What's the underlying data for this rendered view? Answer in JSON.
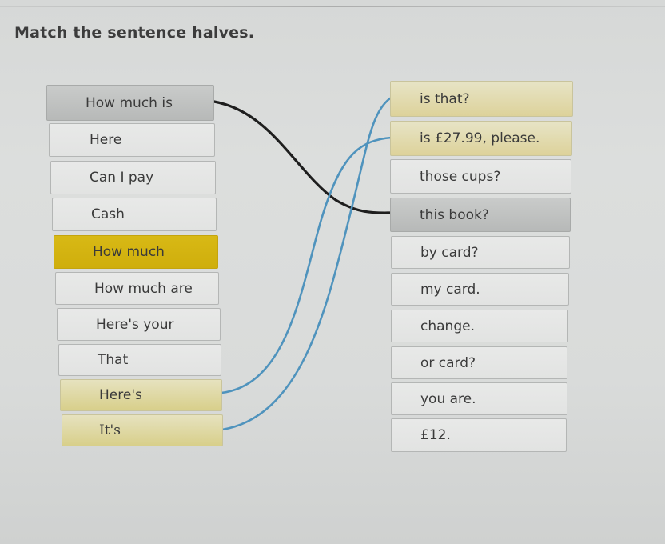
{
  "title": "Match the sentence halves.",
  "left_items": [
    {
      "label": "How much is",
      "state": "matched-dark"
    },
    {
      "label": "Here",
      "state": "default"
    },
    {
      "label": "Can I pay",
      "state": "default"
    },
    {
      "label": "Cash",
      "state": "default"
    },
    {
      "label": "How much",
      "state": "selected"
    },
    {
      "label": "How much are",
      "state": "default"
    },
    {
      "label": "Here's your",
      "state": "default"
    },
    {
      "label": "That",
      "state": "default"
    },
    {
      "label": "Here's",
      "state": "matched-blue"
    },
    {
      "label": "It's",
      "state": "matched-blue"
    }
  ],
  "right_items": [
    {
      "label": "is that?",
      "state": "matched-blue"
    },
    {
      "label": "is £27.99, please.",
      "state": "matched-blue"
    },
    {
      "label": "those cups?",
      "state": "default"
    },
    {
      "label": "this book?",
      "state": "matched-dark"
    },
    {
      "label": "by card?",
      "state": "default"
    },
    {
      "label": "my card.",
      "state": "default"
    },
    {
      "label": "change.",
      "state": "default"
    },
    {
      "label": "or card?",
      "state": "default"
    },
    {
      "label": "you are.",
      "state": "default"
    },
    {
      "label": "£12.",
      "state": "default"
    }
  ],
  "connections": [
    {
      "from": "How much is",
      "to": "this book?",
      "color": "#1e1e1e"
    },
    {
      "from": "Here's",
      "to": "is £27.99, please.",
      "color": "#4f93bd"
    },
    {
      "from": "It's",
      "to": "is that?",
      "color": "#4f93bd"
    }
  ]
}
